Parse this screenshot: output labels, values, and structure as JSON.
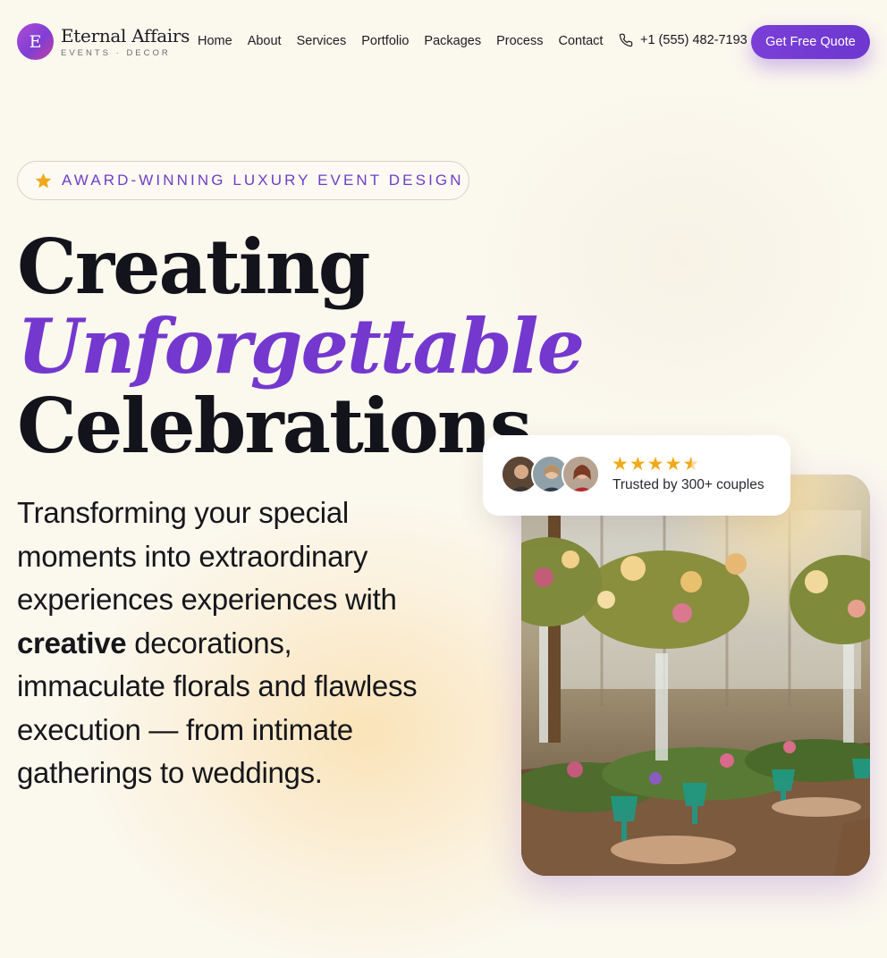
{
  "brand": {
    "initial": "E",
    "name": "Eternal Affairs",
    "tagline": "EVENTS · DECOR"
  },
  "nav": {
    "items": [
      {
        "label": "Home"
      },
      {
        "label": "About"
      },
      {
        "label": "Services"
      },
      {
        "label": "Portfolio"
      },
      {
        "label": "Packages"
      },
      {
        "label": "Process"
      },
      {
        "label": "Contact"
      }
    ],
    "phone": "+1 (555) 482-7193",
    "cta_label": "Get Free Quote"
  },
  "hero": {
    "badge_icon": "star-icon",
    "badge_text": "AWARD-WINNING LUXURY EVENT DESIGN",
    "headline_line1": "Creating",
    "headline_accent": "Unforgettable",
    "headline_line3": "Celebrations",
    "lead_before": "Transforming your special moments into extraordinary experiences experiences with ",
    "lead_bold": "creative",
    "lead_after": " decorations, immaculate florals and flawless execution — from intimate gatherings to weddings."
  },
  "trust": {
    "rating_stars": 4.5,
    "text": "Trusted by 300+ couples"
  },
  "colors": {
    "accent": "#7438cf",
    "background": "#fbf8ee",
    "star": "#f0a91c"
  }
}
